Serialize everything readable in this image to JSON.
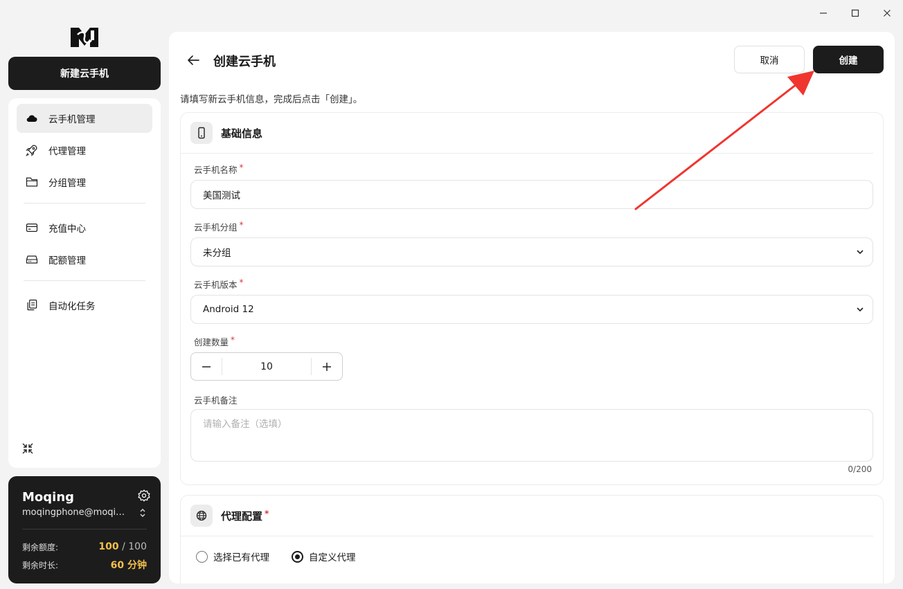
{
  "window": {
    "minimize": "—",
    "maximize": "☐",
    "close": "✕"
  },
  "sidebar": {
    "new_button": "新建云手机",
    "items": [
      {
        "label": "云手机管理",
        "icon": "cloud-icon",
        "active": true
      },
      {
        "label": "代理管理",
        "icon": "rocket-icon"
      },
      {
        "label": "分组管理",
        "icon": "folder-icon"
      },
      {
        "label": "充值中心",
        "icon": "credit-card-icon"
      },
      {
        "label": "配额管理",
        "icon": "server-icon"
      },
      {
        "label": "自动化任务",
        "icon": "clipboard-icon"
      }
    ]
  },
  "user": {
    "name": "Moqing",
    "email": "moqingphone@moqing....",
    "quota_label": "剩余额度:",
    "quota_used": "100",
    "quota_sep": " / ",
    "quota_total": "100",
    "time_label": "剩余时长:",
    "time_value": "60",
    "time_unit": " 分钟"
  },
  "header": {
    "title": "创建云手机",
    "cancel": "取消",
    "create": "创建",
    "subtitle": "请填写新云手机信息，完成后点击「创建」。"
  },
  "basic": {
    "title": "基础信息",
    "name_label": "云手机名称",
    "name_value": "美国测试",
    "group_label": "云手机分组",
    "group_value": "未分组",
    "version_label": "云手机版本",
    "version_value": "Android 12",
    "count_label": "创建数量",
    "count_value": "10",
    "note_label": "云手机备注",
    "note_placeholder": "请输入备注（选填）",
    "note_counter": "0/200",
    "required_mark": "*"
  },
  "proxy": {
    "title": "代理配置",
    "option_existing": "选择已有代理",
    "option_custom": "自定义代理",
    "selected": "自定义代理"
  },
  "annotation": {
    "arrow_color": "#f0352f"
  }
}
